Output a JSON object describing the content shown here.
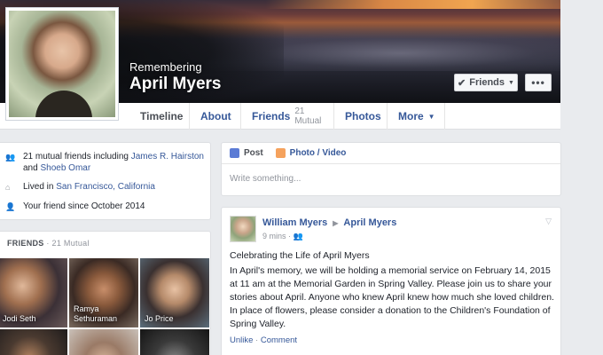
{
  "cover": {
    "remembering": "Remembering",
    "name": "April Myers",
    "friends_button": "Friends",
    "more_button": "•••"
  },
  "nav": {
    "tabs": [
      {
        "label": "Timeline"
      },
      {
        "label": "About"
      },
      {
        "label": "Friends",
        "sub": "21 Mutual"
      },
      {
        "label": "Photos"
      },
      {
        "label": "More"
      }
    ]
  },
  "intro": {
    "mutual_prefix": "21 mutual friends including",
    "mutual_friend_1": "James R. Hairston",
    "mutual_and": "and",
    "mutual_friend_2": "Shoeb Omar",
    "lived_prefix": "Lived in",
    "lived_place": "San Francisco, California",
    "friend_since": "Your friend since October 2014"
  },
  "friends": {
    "title": "FRIENDS",
    "sub": "· 21 Mutual",
    "tiles": [
      {
        "name": "Jodi Seth"
      },
      {
        "name": "Ramya Sethuraman"
      },
      {
        "name": "Jo Price"
      },
      {
        "name": ""
      },
      {
        "name": ""
      },
      {
        "name": ""
      }
    ]
  },
  "composer": {
    "post_tab": "Post",
    "photo_tab": "Photo / Video",
    "placeholder": "Write something..."
  },
  "post": {
    "author": "William Myers",
    "target": "April Myers",
    "time": "9 mins ·",
    "title": "Celebrating the Life of April Myers",
    "body": "In April's memory, we will be holding a memorial service on February 14, 2015 at 11 am at the Memorial Garden in Spring Valley. Please join us to share your stories about April. Anyone who knew April knew how much she loved children. In place of flowers, please consider a donation to the Children's Foundation of Spring Valley.",
    "unlike": "Unlike",
    "separator": "·",
    "comment": "Comment"
  },
  "colors": {
    "link": "#365899",
    "meta": "#90949c",
    "background": "#e9ebee"
  }
}
